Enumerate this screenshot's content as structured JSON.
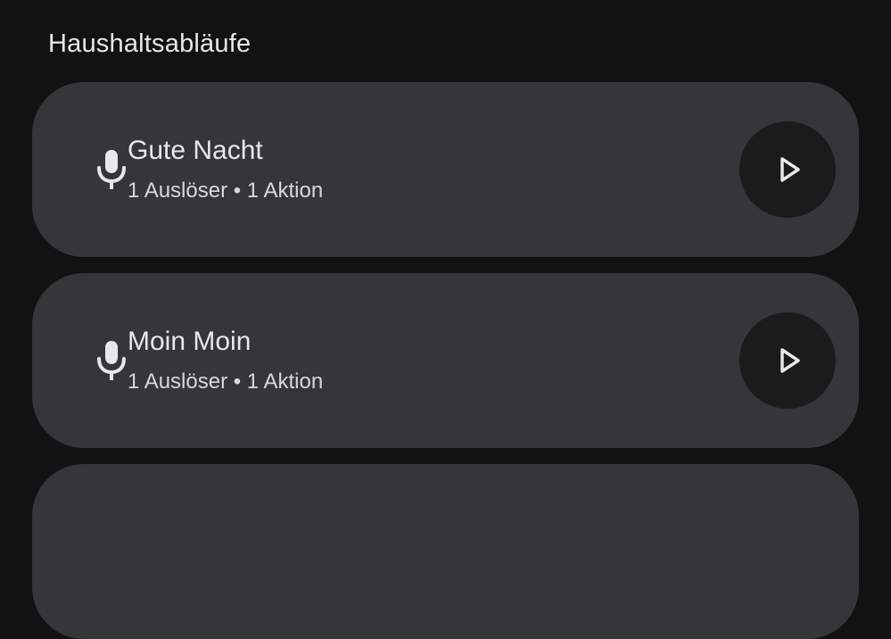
{
  "section": {
    "title": "Haushaltsabläufe"
  },
  "routines": [
    {
      "name": "Gute Nacht",
      "details": "1 Auslöser • 1 Aktion",
      "icon": "microphone-icon",
      "action_icon": "play-icon"
    },
    {
      "name": "Moin Moin",
      "details": "1 Auslöser • 1 Aktion",
      "icon": "microphone-icon",
      "action_icon": "play-icon"
    }
  ],
  "colors": {
    "background": "#121212",
    "card": "#35363a",
    "play_button": "#1b1b1c",
    "text": "#e8e8ea"
  }
}
